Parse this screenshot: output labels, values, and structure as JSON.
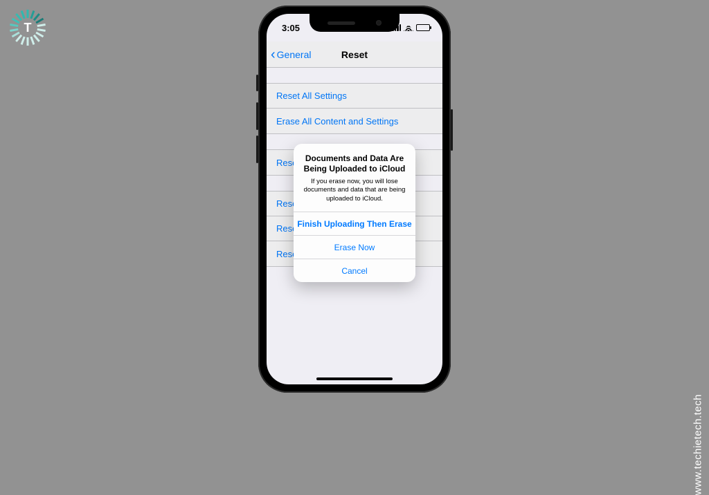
{
  "brand": {
    "logo_letter": "T",
    "watermark": "www.techietech.tech"
  },
  "statusbar": {
    "time": "3:05"
  },
  "navbar": {
    "back_label": "General",
    "title": "Reset"
  },
  "settings": {
    "group1": [
      {
        "label": "Reset All Settings"
      },
      {
        "label": "Erase All Content and Settings"
      }
    ],
    "group2": [
      {
        "label": "Reset Network Settings"
      }
    ],
    "group3": [
      {
        "label": "Reset Keyboard Dictionary"
      },
      {
        "label": "Reset Home Screen Layout"
      },
      {
        "label": "Reset Location & Privacy"
      }
    ]
  },
  "alert": {
    "title": "Documents and Data Are Being Uploaded to iCloud",
    "message": "If you erase now, you will lose documents and data that are being uploaded to iCloud.",
    "buttons": {
      "primary": "Finish Uploading Then Erase",
      "secondary": "Erase Now",
      "cancel": "Cancel"
    }
  }
}
